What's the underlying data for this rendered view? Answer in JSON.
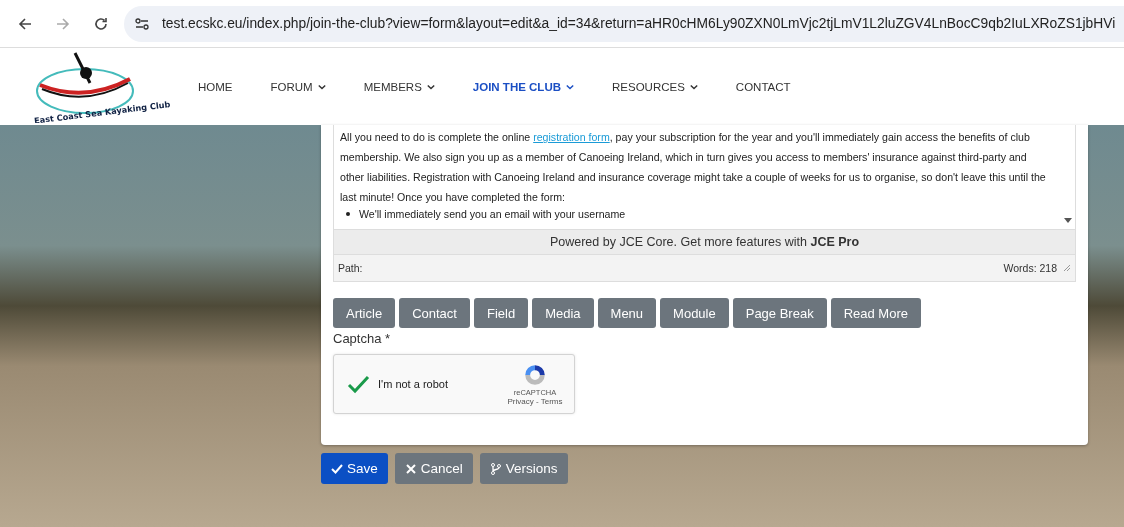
{
  "browser": {
    "url": "test.ecskc.eu/index.php/join-the-club?view=form&layout=edit&a_id=34&return=aHR0cHM6Ly90ZXN0LmVjc2tjLmV1L2luZGV4LnBocC9qb2IuLXRoZS1jbHVi"
  },
  "header": {
    "logo_text": "East Coast Sea Kayaking Club",
    "nav": [
      {
        "label": "HOME",
        "has_menu": false,
        "selected": false
      },
      {
        "label": "FORUM",
        "has_menu": true,
        "selected": false
      },
      {
        "label": "MEMBERS",
        "has_menu": true,
        "selected": false
      },
      {
        "label": "JOIN THE CLUB",
        "has_menu": true,
        "selected": true
      },
      {
        "label": "RESOURCES",
        "has_menu": true,
        "selected": false
      },
      {
        "label": "CONTACT",
        "has_menu": false,
        "selected": false
      }
    ]
  },
  "editor": {
    "paragraph": {
      "before": "All you need to do is complete the online",
      "link": "registration form",
      "after": ", pay your subscription for the year and you'll immediately gain access the benefits of club membership. We also sign you up as a member of Canoeing Ireland, which in turn gives you access to members' insurance against third-party and other liabilities. Registration with Canoeing Ireland and insurance coverage might take a couple of weeks for us to organise, so don't leave this until the last minute! Once you have completed the form:"
    },
    "bullets": [
      "We'll immediately send you an email with your username"
    ],
    "powered_by": "Powered by JCE Core. Get more features with **JCE Pro**",
    "path_label": "Path:",
    "word_count": "Words: 218"
  },
  "insert_buttons": [
    "Article",
    "Contact",
    "Field",
    "Media",
    "Menu",
    "Module",
    "Page Break",
    "Read More"
  ],
  "captcha": {
    "label": "Captcha *",
    "checked": true,
    "text": "I'm not a robot",
    "brand": "reCAPTCHA",
    "privacy": "Privacy",
    "separator": "-",
    "terms": "Terms"
  },
  "actions": [
    {
      "label": "Save",
      "kind": "primary"
    },
    {
      "label": "Cancel",
      "kind": "cancel"
    },
    {
      "label": "Versions",
      "kind": "versions"
    }
  ]
}
